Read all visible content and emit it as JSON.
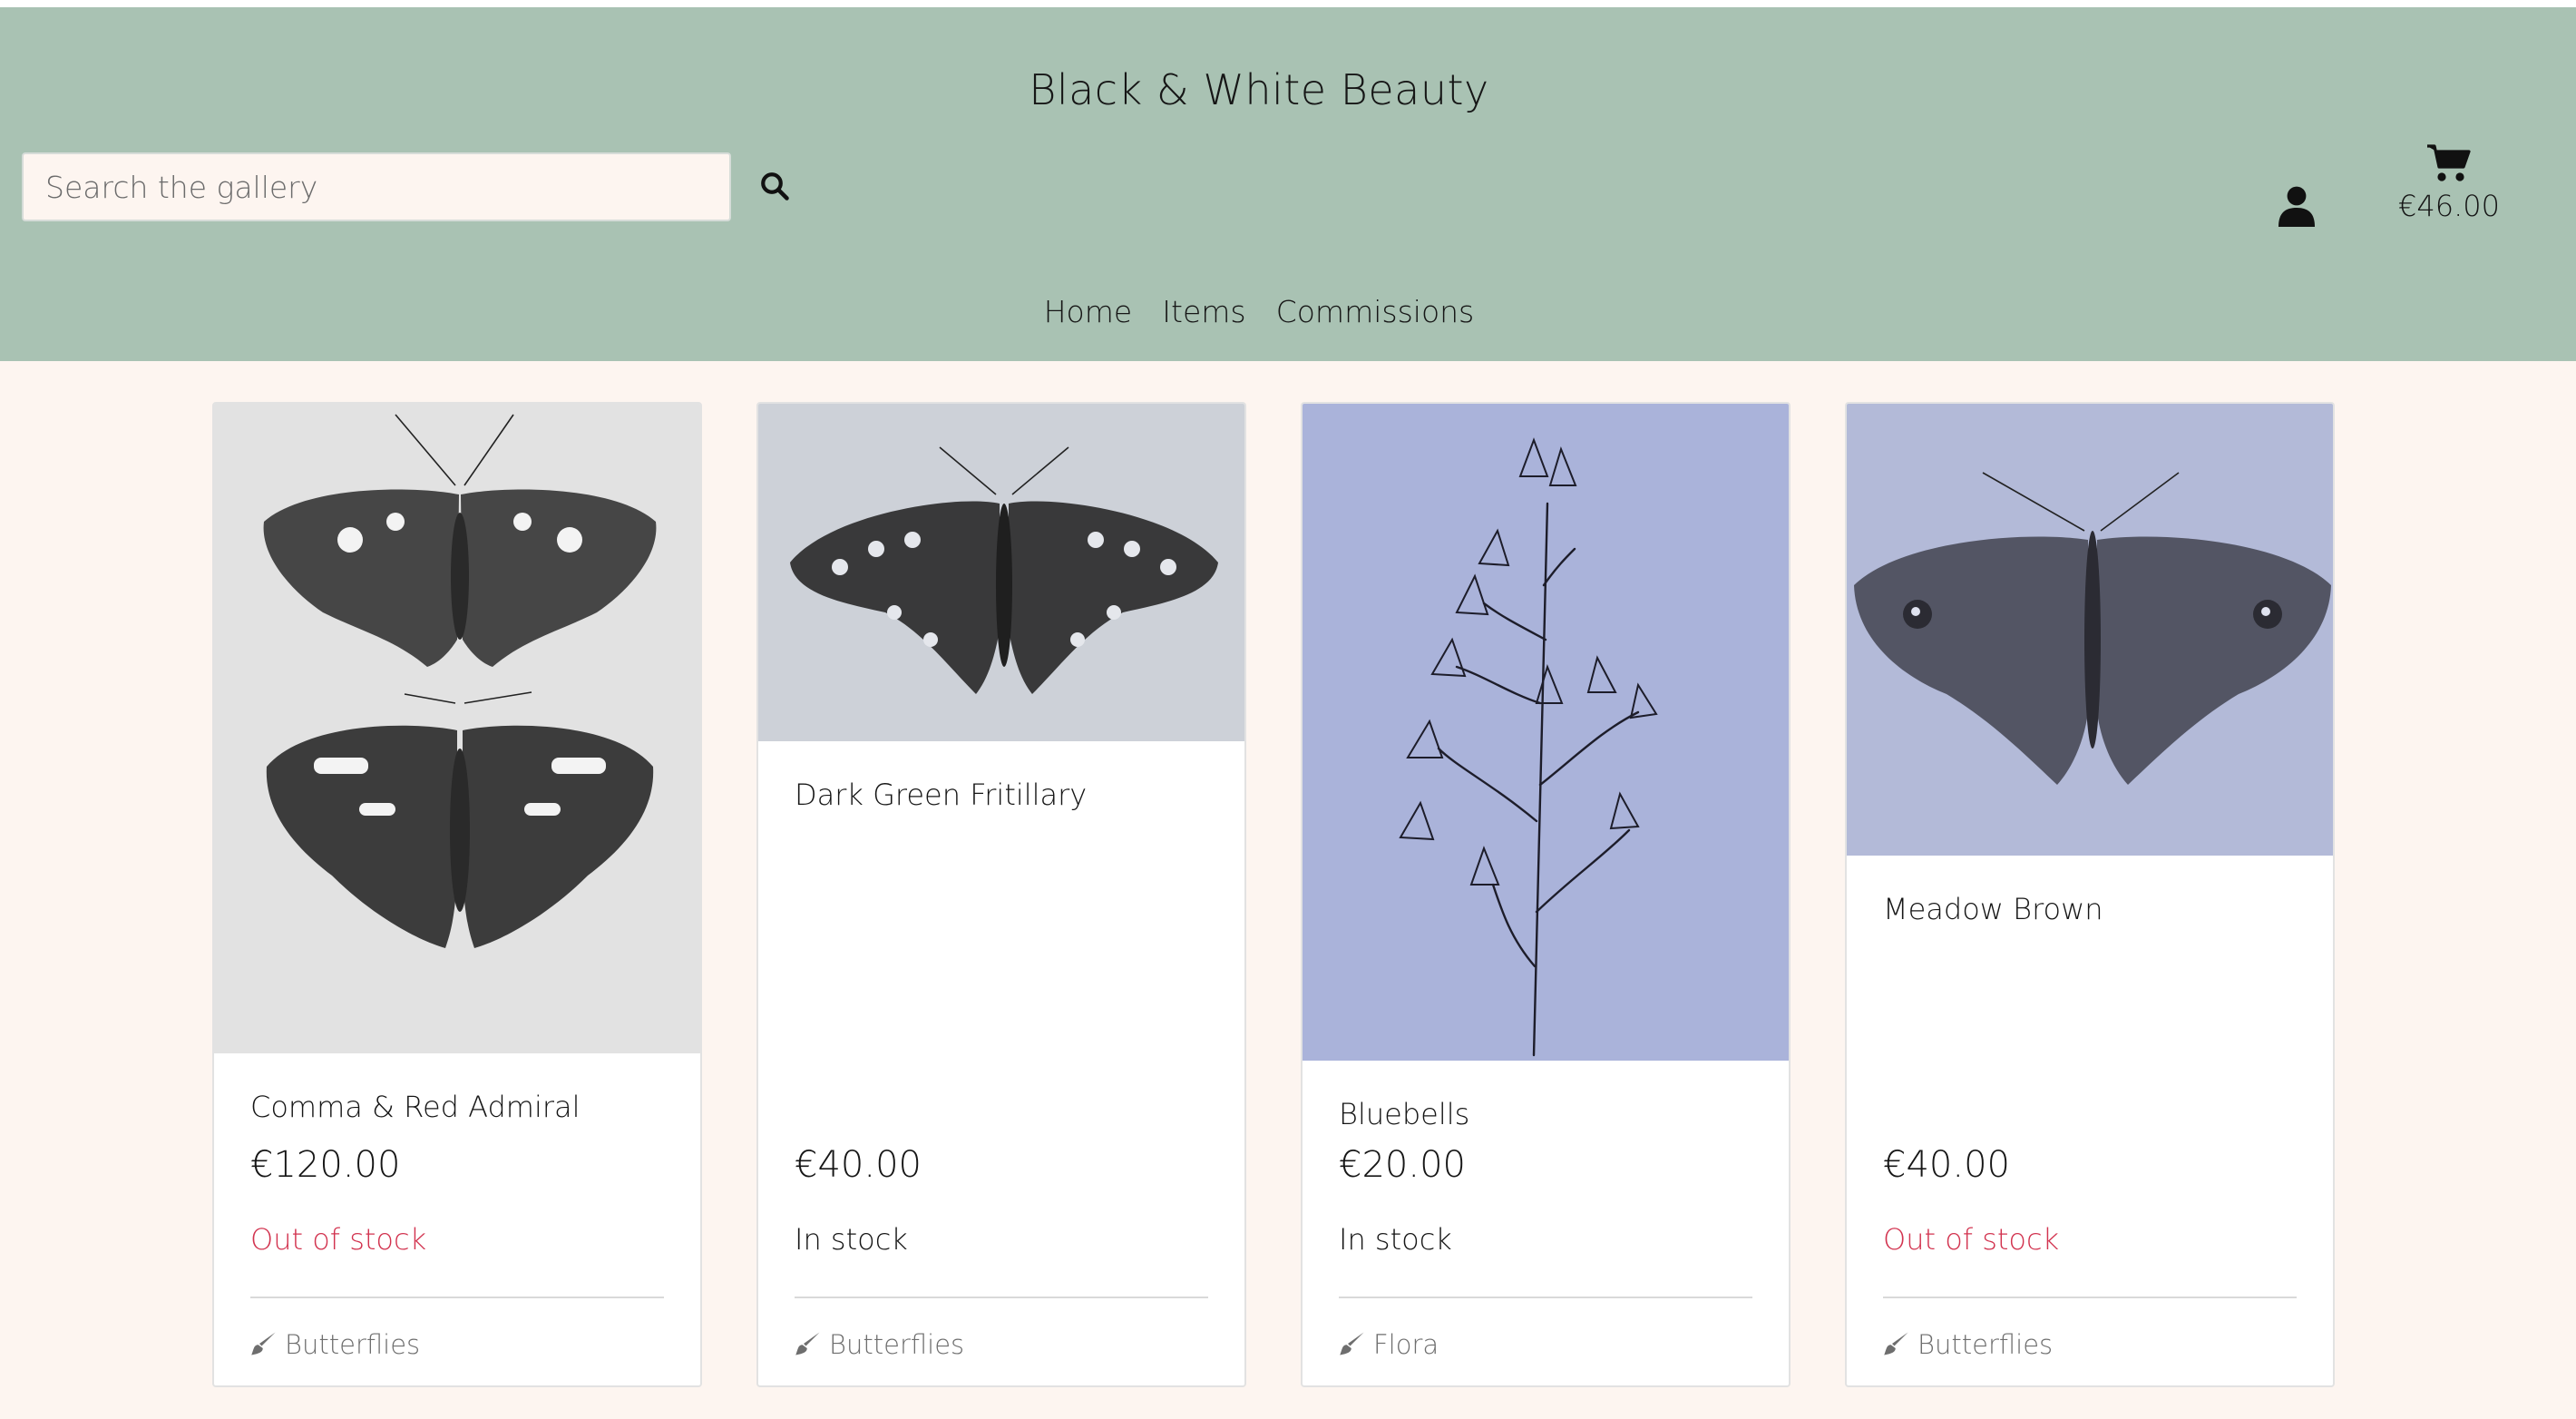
{
  "header": {
    "brand": "Black & White Beauty",
    "search_placeholder": "Search the gallery",
    "search_icon": "search-icon",
    "account_icon": "user-icon",
    "cart_icon": "shopping-cart-icon",
    "cart_total": "€46.00",
    "bg_color": "#a9c2b3"
  },
  "nav": {
    "items": [
      {
        "label": "Home"
      },
      {
        "label": "Items"
      },
      {
        "label": "Commissions"
      }
    ]
  },
  "products": [
    {
      "title": "Comma & Red Admiral",
      "price": "€120.00",
      "stock": "Out of stock",
      "category": "Butterflies",
      "category_icon": "paintbrush-icon"
    },
    {
      "title": "Dark Green Fritillary",
      "price": "€40.00",
      "stock": "In stock",
      "category": "Butterflies",
      "category_icon": "paintbrush-icon"
    },
    {
      "title": "Bluebells",
      "price": "€20.00",
      "stock": "In stock",
      "category": "Flora",
      "category_icon": "paintbrush-icon"
    },
    {
      "title": "Meadow Brown",
      "price": "€40.00",
      "stock": "Out of stock",
      "category": "Butterflies",
      "category_icon": "paintbrush-icon"
    }
  ],
  "colors": {
    "out_of_stock": "#d2334f",
    "page_bg": "#fdf5f0"
  }
}
